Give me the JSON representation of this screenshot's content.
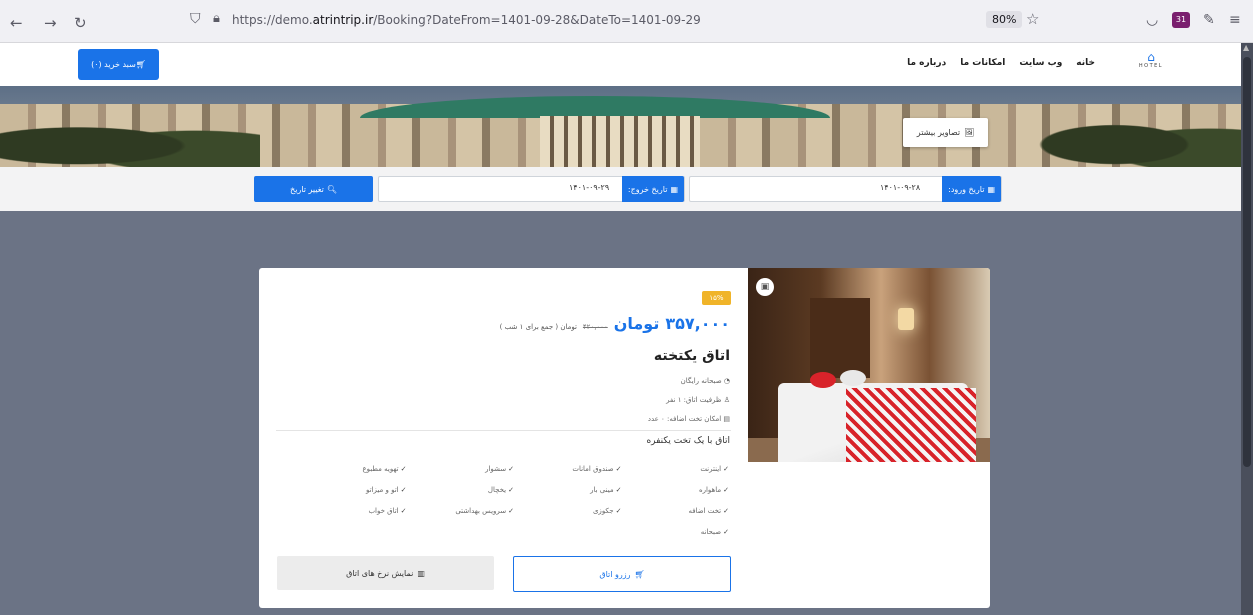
{
  "browser": {
    "url_prefix": "https://demo.",
    "url_domain": "atrintrip.ir",
    "url_path": "/Booking?DateFrom=1401-09-28&DateTo=1401-09-29",
    "zoom": "80%",
    "ext_badge": "31"
  },
  "header": {
    "cart_label": "سبد خرید (۰)",
    "nav": [
      "خانه",
      "وب سایت",
      "امکانات ما",
      "درباره ما"
    ],
    "logo_text": "HOTEL"
  },
  "hero": {
    "more_photos": "تصاویر بیشتر"
  },
  "search": {
    "checkin_label": "تاریخ ورود:",
    "checkin_value": "۱۴۰۱-۰۹-۲۸",
    "checkout_label": "تاریخ خروج:",
    "checkout_value": "۱۴۰۱-۰۹-۲۹",
    "change_label": "تغییر تاریخ"
  },
  "room": {
    "discount": "۱۵%",
    "price": "۳۵۷,۰۰۰",
    "currency": "تومان",
    "old_price": "۴۲۰,۰۰۰",
    "price_note": "تومان ( جمع برای ۱ شب )",
    "title": "اتاق یکتخته",
    "features": [
      "صبحانه رایگان",
      "ظرفیت اتاق: ۱ نفر",
      "امکان تخت اضافه: ۰ عدد"
    ],
    "subtitle": "اتاق با یک تخت یکنفره",
    "amenities": [
      "اینترنت",
      "صندوق امانات",
      "سشوار",
      "تهویه مطبوع",
      "ماهواره",
      "مینی بار",
      "یخچال",
      "اتو و میزاتو",
      "تخت اضافه",
      "جکوزی",
      "سرویس بهداشتی",
      "اتاق خواب",
      "صبحانه"
    ],
    "reserve_label": "رزرو اتاق",
    "rates_label": "نمایش نرخ های اتاق"
  }
}
